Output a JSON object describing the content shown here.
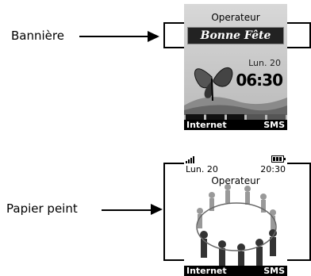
{
  "callouts": {
    "banner_label": "Bannière",
    "wallpaper_label": "Papier peint"
  },
  "screen1": {
    "operator": "Operateur",
    "banner_text": "Bonne Fête",
    "date": "Lun. 20",
    "time": "06:30",
    "softkey_left": "Internet",
    "softkey_right": "SMS"
  },
  "screen2": {
    "operator": "Operateur",
    "date": "Lun. 20",
    "time": "20:30",
    "softkey_left": "Internet",
    "softkey_right": "SMS"
  }
}
